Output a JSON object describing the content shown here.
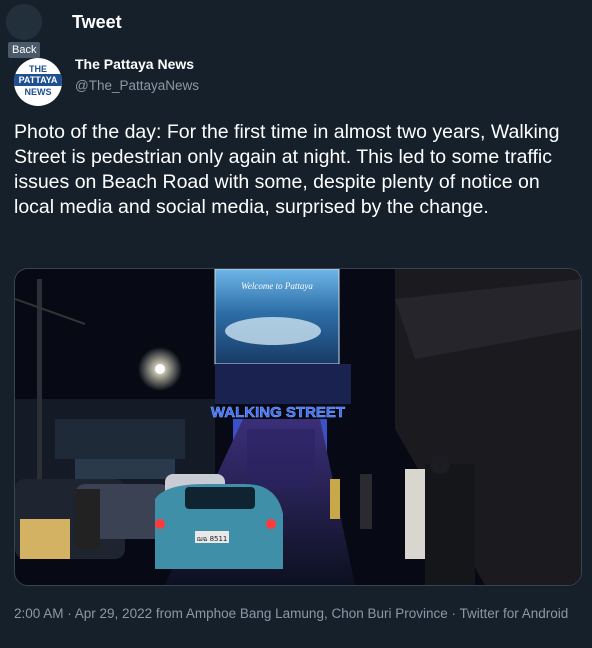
{
  "header": {
    "back_tooltip": "Back",
    "title": "Tweet"
  },
  "author": {
    "avatar_lines": [
      "THE",
      "PATTAYA",
      "NEWS"
    ],
    "name": "The Pattaya News",
    "handle": "@The_PattayaNews"
  },
  "tweet": {
    "text": "Photo of the day: For the first time in almost two years, Walking Street is pedestrian only again at night. This led to some traffic issues on Beach Road with some, despite plenty of notice on local media and social media, surprised by the change.",
    "photo": {
      "billboard_text": "Welcome to Pattaya",
      "sign_text": "WALKING STREET",
      "plate_text": "ฌฉ 8511"
    },
    "meta": "2:00 AM · Apr 29, 2022 from Amphoe Bang Lamung, Chon Buri Province · Twitter for Android"
  },
  "colors": {
    "background": "#15202b",
    "secondary_text": "#8b98a5",
    "sign_blue": "#3a6cff"
  }
}
